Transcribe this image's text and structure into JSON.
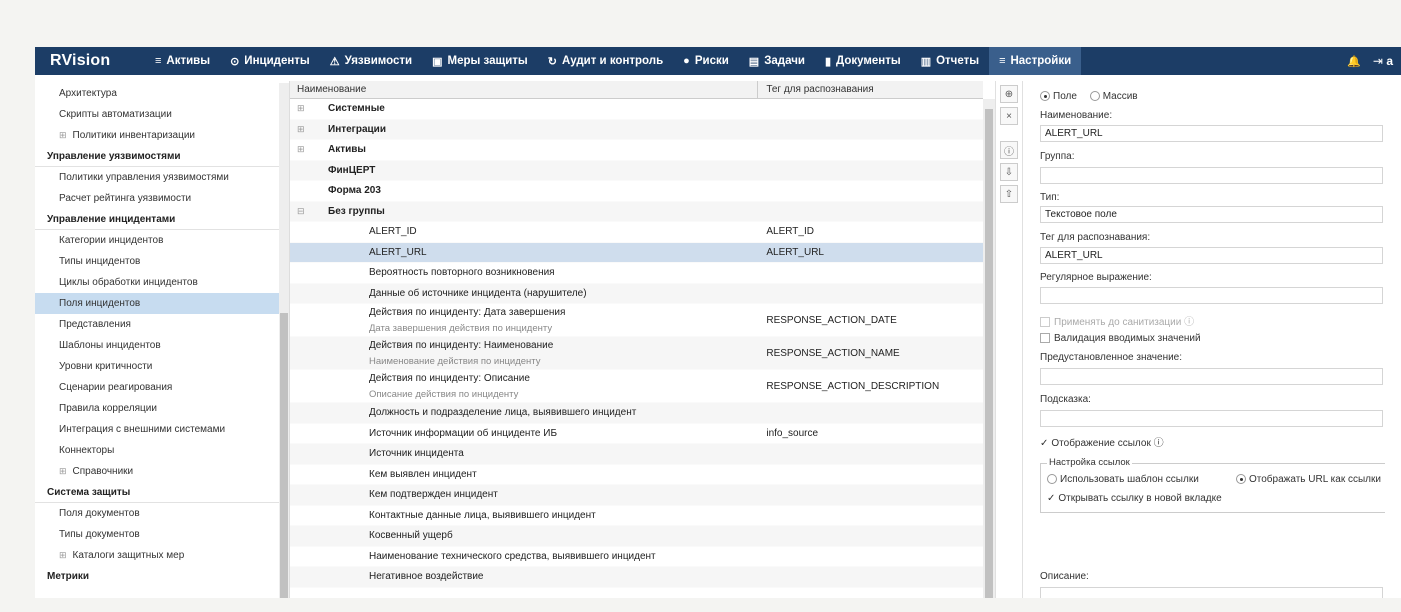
{
  "nav": {
    "logo": "RVision",
    "items": [
      {
        "label": "Активы",
        "icon": "database-icon",
        "glyph": "≡"
      },
      {
        "label": "Инциденты",
        "icon": "target-icon",
        "glyph": "⊙"
      },
      {
        "label": "Уязвимости",
        "icon": "warning-icon",
        "glyph": "⚠"
      },
      {
        "label": "Меры защиты",
        "icon": "shield-icon",
        "glyph": "▣"
      },
      {
        "label": "Аудит и контроль",
        "icon": "refresh-icon",
        "glyph": "↻"
      },
      {
        "label": "Риски",
        "icon": "alert-circle-icon",
        "glyph": "●"
      },
      {
        "label": "Задачи",
        "icon": "tasks-icon",
        "glyph": "▤"
      },
      {
        "label": "Документы",
        "icon": "document-icon",
        "glyph": "▮"
      },
      {
        "label": "Отчеты",
        "icon": "report-icon",
        "glyph": "▥"
      },
      {
        "label": "Настройки",
        "icon": "settings-menu-icon",
        "glyph": "≡"
      }
    ],
    "bell_glyph": "🔔",
    "logout_glyph": "⇥",
    "logout_label": "a"
  },
  "sidebar": {
    "items": [
      {
        "label": "Архитектура",
        "kind": "item"
      },
      {
        "label": "Скрипты автоматизации",
        "kind": "item"
      },
      {
        "label": "Политики инвентаризации",
        "kind": "expand"
      },
      {
        "label": "Управление уязвимостями",
        "kind": "header"
      },
      {
        "label": "Политики управления уязвимостями",
        "kind": "item"
      },
      {
        "label": "Расчет рейтинга уязвимости",
        "kind": "item"
      },
      {
        "label": "Управление инцидентами",
        "kind": "header"
      },
      {
        "label": "Категории инцидентов",
        "kind": "item"
      },
      {
        "label": "Типы инцидентов",
        "kind": "item"
      },
      {
        "label": "Циклы обработки инцидентов",
        "kind": "item"
      },
      {
        "label": "Поля инцидентов",
        "kind": "selected"
      },
      {
        "label": "Представления",
        "kind": "item"
      },
      {
        "label": "Шаблоны инцидентов",
        "kind": "item"
      },
      {
        "label": "Уровни критичности",
        "kind": "item"
      },
      {
        "label": "Сценарии реагирования",
        "kind": "item"
      },
      {
        "label": "Правила корреляции",
        "kind": "item"
      },
      {
        "label": "Интеграция с внешними системами",
        "kind": "item"
      },
      {
        "label": "Коннекторы",
        "kind": "item"
      },
      {
        "label": "Справочники",
        "kind": "expand"
      },
      {
        "label": "Система защиты",
        "kind": "header"
      },
      {
        "label": "Поля документов",
        "kind": "item"
      },
      {
        "label": "Типы документов",
        "kind": "item"
      },
      {
        "label": "Каталоги защитных мер",
        "kind": "expand"
      },
      {
        "label": "Метрики",
        "kind": "header-plain"
      }
    ],
    "expand_glyph": "⊞"
  },
  "table": {
    "col_name": "Наименование",
    "col_tag": "Тег для распознавания",
    "rows": [
      {
        "kind": "group",
        "name": "Системные",
        "toggle": "⊞",
        "tag": ""
      },
      {
        "kind": "group",
        "name": "Интеграции",
        "toggle": "⊞",
        "tag": ""
      },
      {
        "kind": "group",
        "name": "Активы",
        "toggle": "⊞",
        "tag": ""
      },
      {
        "kind": "group",
        "name": "ФинЦЕРТ",
        "toggle": "",
        "tag": ""
      },
      {
        "kind": "group",
        "name": "Форма 203",
        "toggle": "",
        "tag": ""
      },
      {
        "kind": "group",
        "name": "Без группы",
        "toggle": "⊟",
        "tag": ""
      },
      {
        "kind": "leaf",
        "name": "ALERT_ID",
        "sub": "",
        "tag": "ALERT_ID"
      },
      {
        "kind": "leaf",
        "name": "ALERT_URL",
        "sub": "",
        "tag": "ALERT_URL",
        "selected": true
      },
      {
        "kind": "leaf",
        "name": "Вероятность повторного возникновения",
        "sub": "",
        "tag": ""
      },
      {
        "kind": "leaf",
        "name": "Данные об источнике инцидента (нарушителе)",
        "sub": "",
        "tag": ""
      },
      {
        "kind": "leaf",
        "name": "Действия по инциденту: Дата завершения",
        "sub": "Дата завершения действия по инциденту",
        "tag": "RESPONSE_ACTION_DATE"
      },
      {
        "kind": "leaf",
        "name": "Действия по инциденту: Наименование",
        "sub": "Наименование действия по инциденту",
        "tag": "RESPONSE_ACTION_NAME"
      },
      {
        "kind": "leaf",
        "name": "Действия по инциденту: Описание",
        "sub": "Описание действия по инциденту",
        "tag": "RESPONSE_ACTION_DESCRIPTION"
      },
      {
        "kind": "leaf",
        "name": "Должность и подразделение лица, выявившего инцидент",
        "sub": "",
        "tag": ""
      },
      {
        "kind": "leaf",
        "name": "Источник информации об инциденте ИБ",
        "sub": "",
        "tag": "info_source"
      },
      {
        "kind": "leaf",
        "name": "Источник инцидента",
        "sub": "",
        "tag": ""
      },
      {
        "kind": "leaf",
        "name": "Кем выявлен инцидент",
        "sub": "",
        "tag": ""
      },
      {
        "kind": "leaf",
        "name": "Кем подтвержден инцидент",
        "sub": "",
        "tag": ""
      },
      {
        "kind": "leaf",
        "name": "Контактные данные лица, выявившего инцидент",
        "sub": "",
        "tag": ""
      },
      {
        "kind": "leaf",
        "name": "Косвенный ущерб",
        "sub": "",
        "tag": ""
      },
      {
        "kind": "leaf",
        "name": "Наименование технического средства, выявившего инцидент",
        "sub": "",
        "tag": ""
      },
      {
        "kind": "leaf",
        "name": "Негативное воздействие",
        "sub": "",
        "tag": ""
      }
    ]
  },
  "toolbar": {
    "buttons": [
      {
        "name": "add-button",
        "glyph": "⊕"
      },
      {
        "name": "delete-button",
        "glyph": "×"
      },
      {
        "name": "info-button",
        "glyph": "ⓘ"
      },
      {
        "name": "import-button",
        "glyph": "⇩"
      },
      {
        "name": "export-button",
        "glyph": "⇧"
      }
    ]
  },
  "form": {
    "radio_field": "Поле",
    "radio_array": "Массив",
    "name_label": "Наименование:",
    "name_value": "ALERT_URL",
    "group_label": "Группа:",
    "group_value": "",
    "type_label": "Тип:",
    "type_value": "Текстовое поле",
    "tag_label": "Тег для распознавания:",
    "tag_value": "ALERT_URL",
    "regex_label": "Регулярное выражение:",
    "regex_value": "",
    "sanitize_label": "Применять до санитизации ⓘ",
    "validation_label": "Валидация вводимых значений",
    "default_label": "Предустановленное значение:",
    "default_value": "",
    "hint_label": "Подсказка:",
    "hint_value": "",
    "show_links_label": "Отображение ссылок ⓘ",
    "link_settings_label": "Настройка ссылок",
    "use_template_label": "Использовать шаблон ссылки",
    "show_url_label": "Отображать URL как ссылки",
    "open_new_tab_label": "Открывать ссылку в новой вкладке",
    "description_label": "Описание:",
    "check_glyph": "✓"
  }
}
